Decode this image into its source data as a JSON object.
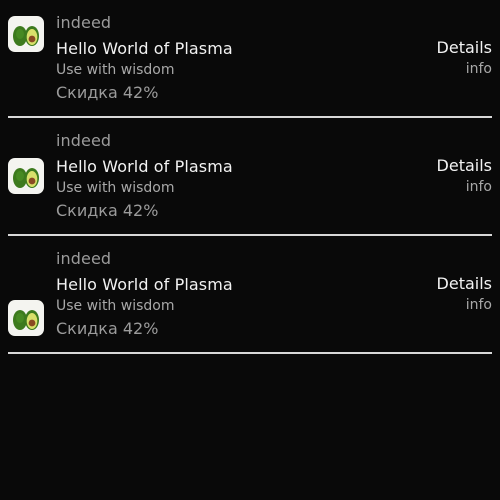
{
  "notifications": [
    {
      "tag": "indeed",
      "title": "Hello World of Plasma",
      "subtitle": "Use with wisdom",
      "discount": "Скидка 42%",
      "action": "Details",
      "action_sub": "info",
      "icon": "avocado-icon"
    },
    {
      "tag": "indeed",
      "title": "Hello World of Plasma",
      "subtitle": "Use with wisdom",
      "discount": "Скидка 42%",
      "action": "Details",
      "action_sub": "info",
      "icon": "avocado-icon"
    },
    {
      "tag": "indeed",
      "title": "Hello World of Plasma",
      "subtitle": "Use with wisdom",
      "discount": "Скидка 42%",
      "action": "Details",
      "action_sub": "info",
      "icon": "avocado-icon"
    }
  ],
  "colors": {
    "background": "#090909",
    "primary_text": "#f2f2f2",
    "secondary_text": "#9b9b9b",
    "divider": "#d8d8d8",
    "avocado_skin": "#3d7a1e",
    "avocado_flesh": "#d8e06a",
    "avocado_pit": "#8a4a22"
  }
}
